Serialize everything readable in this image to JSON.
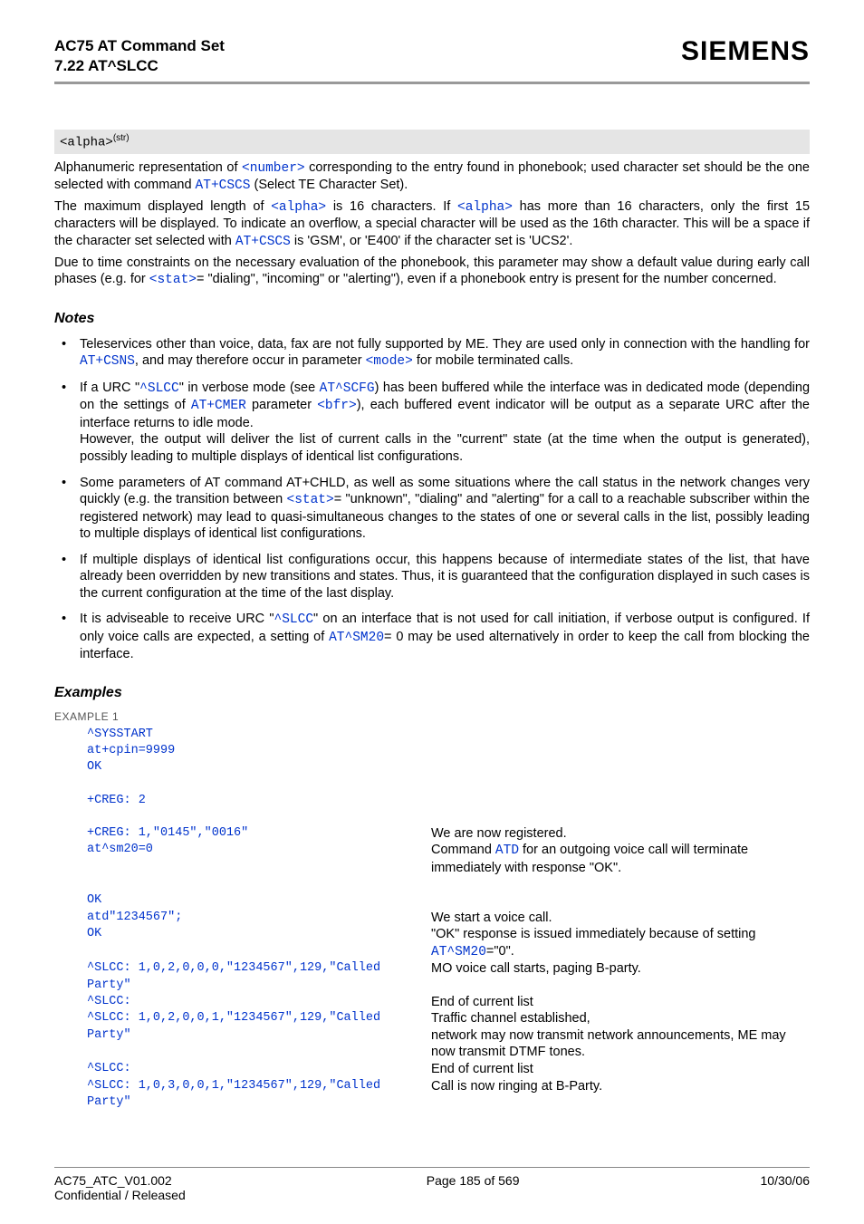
{
  "header": {
    "title_line1": "AC75 AT Command Set",
    "title_line2": "7.22 AT^SLCC",
    "brand": "SIEMENS"
  },
  "param": {
    "name": "<alpha>",
    "sup": "(str)"
  },
  "para1_a": "Alphanumeric representation of ",
  "para1_b": "<number>",
  "para1_c": " corresponding to the entry found in phonebook; used character set should be the one selected with command ",
  "para1_d": "AT+CSCS",
  "para1_e": " (Select TE Character Set).",
  "para2_a": "The maximum displayed length of ",
  "para2_b": "<alpha>",
  "para2_c": " is 16 characters. If ",
  "para2_d": "<alpha>",
  "para2_e": " has more than 16 characters, only the first 15 characters will be displayed. To indicate an overflow, a special character will be used as the 16th character. This will be a space if the character set selected with ",
  "para2_f": "AT+CSCS",
  "para2_g": " is 'GSM', or 'E400' if the character set is 'UCS2'.",
  "para3_a": "Due to time constraints on the necessary evaluation of the phonebook, this parameter may show a default value during early call phases (e.g. for ",
  "para3_b": "<stat>",
  "para3_c": "= \"dialing\", \"incoming\" or \"alerting\"), even if a phonebook entry is present for the number concerned.",
  "notes_title": "Notes",
  "notes": {
    "n1_a": "Teleservices other than voice, data, fax are not fully supported by ME. They are used only in connection with the handling for ",
    "n1_b": "AT+CSNS",
    "n1_c": ", and may therefore occur in parameter ",
    "n1_d": "<mode>",
    "n1_e": " for mobile terminated calls.",
    "n2_a": "If a URC \"",
    "n2_b": "^SLCC",
    "n2_c": "\" in verbose mode (see ",
    "n2_d": "AT^SCFG",
    "n2_e": ") has been buffered while the interface was in dedicated mode (depending on the settings of ",
    "n2_f": "AT+CMER",
    "n2_g": " parameter ",
    "n2_h": "<bfr>",
    "n2_i": "), each buffered event indicator will be output as a separate URC after the interface returns to idle mode.",
    "n2_j": "However, the output will deliver the list of current calls in the \"current\" state (at the time when the output is generated), possibly leading to multiple displays of identical list configurations.",
    "n3_a": "Some parameters of AT command AT+CHLD, as well as some situations where the call status in the network changes very quickly (e.g. the transition between ",
    "n3_b": "<stat>",
    "n3_c": "= \"unknown\", \"dialing\" and \"alerting\" for a call to a reachable subscriber within the registered network) may lead to quasi-simultaneous changes to the states of one or several calls in the list, possibly leading to multiple displays of identical list configurations.",
    "n4": "If multiple displays of identical list configurations occur, this happens because of intermediate states of the list, that have already been overridden by new transitions and states. Thus, it is guaranteed that the configuration displayed in such cases is the current configuration at the time of the last display.",
    "n5_a": "It is adviseable to receive URC \"",
    "n5_b": "^SLCC",
    "n5_c": "\" on an interface that is not used for call initiation, if verbose output is configured. If only voice calls are expected, a setting of ",
    "n5_d": "AT^SM20",
    "n5_e": "= 0 may be used alternatively in order to keep the call from blocking the interface."
  },
  "examples_title": "Examples",
  "example_label": "EXAMPLE 1",
  "ex": {
    "l1": "^SYSSTART",
    "l2": "at+cpin=9999",
    "l3": "OK",
    "l4": "+CREG: 2",
    "l5": "+CREG: 1,\"0145\",\"0016\"",
    "r5": "We are now registered.",
    "l6": "at^sm20=0",
    "r6_a": "Command ",
    "r6_b": "ATD",
    "r6_c": " for an outgoing voice call will terminate immediately with response \"OK\".",
    "l7": "OK",
    "l8": "atd\"1234567\";",
    "r8": "We start a voice call.",
    "l9": "OK",
    "r9_a": "\"OK\" response is issued immediately because of setting ",
    "r9_b": "AT^SM20",
    "r9_c": "=\"0\".",
    "l10": "^SLCC: 1,0,2,0,0,0,\"1234567\",129,\"Called Party\"",
    "r10": "MO voice call starts, paging B-party.",
    "l11": "^SLCC:",
    "r11": "End of current list",
    "l12": "^SLCC: 1,0,2,0,0,1,\"1234567\",129,\"Called Party\"",
    "r12_a": "Traffic channel established,",
    "r12_b": "network may now transmit network announcements, ME may now transmit DTMF tones.",
    "l13": "^SLCC:",
    "r13": "End of current list",
    "l14": "^SLCC: 1,0,3,0,0,1,\"1234567\",129,\"Called Party\"",
    "r14": "Call is now ringing at B-Party."
  },
  "footer": {
    "left_line1": "AC75_ATC_V01.002",
    "left_line2": "Confidential / Released",
    "center": "Page 185 of 569",
    "right": "10/30/06"
  }
}
